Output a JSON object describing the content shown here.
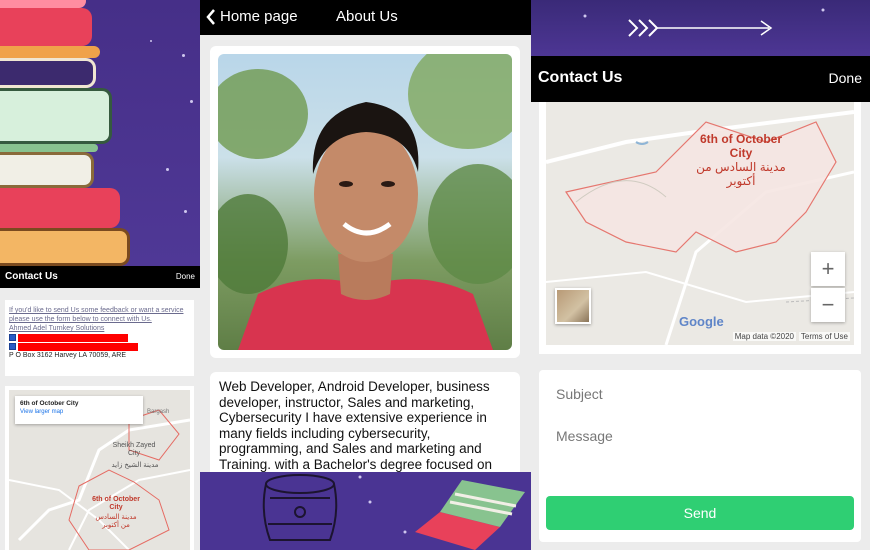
{
  "left_panel": {
    "contact_bar": {
      "title": "Contact Us",
      "done_label": "Done"
    },
    "info": {
      "feedback_text": "If you'd like to send Us some feedback or want a service please use the form below to connect with Us.",
      "company": "Ahmed Adel Turnkey Solutions",
      "address": "P O Box 3162 Harvey LA 70059, ARE"
    },
    "map": {
      "popup_title": "6th of October City",
      "popup_link": "View larger map",
      "label_sheikh_en": "Sheikh Zayed City",
      "label_sheikh_ar": "مدينة الشيخ زايد",
      "label_city_en": "6th of October City",
      "label_city_ar": "مدينة السادس من أكتوبر",
      "label_bargash": "Bargash"
    }
  },
  "middle_panel": {
    "nav": {
      "back_label": "Home page",
      "title": "About Us"
    },
    "bio": "Web Developer, Android Developer, business developer, instructor, Sales and marketing, Cybersecurity I have extensive experience in many fields including cybersecurity, programming, and Sales and marketing and Training. with a Bachelor's degree focused on"
  },
  "right_panel": {
    "contact_bar": {
      "title": "Contact Us",
      "done_label": "Done"
    },
    "map": {
      "city_en": "6th of October City",
      "city_ar": "مدينة السادس من أكتوبر",
      "zoom_in": "+",
      "zoom_out": "−",
      "google": "Google",
      "map_data": "Map data ©2020",
      "terms": "Terms of Use"
    },
    "form": {
      "subject_placeholder": "Subject",
      "message_placeholder": "Message",
      "send_label": "Send"
    }
  },
  "colors": {
    "hero_purple": "#4a3493",
    "bar_black": "#000000",
    "send_green": "#2fcf73",
    "link_blue": "#1a73e8"
  }
}
